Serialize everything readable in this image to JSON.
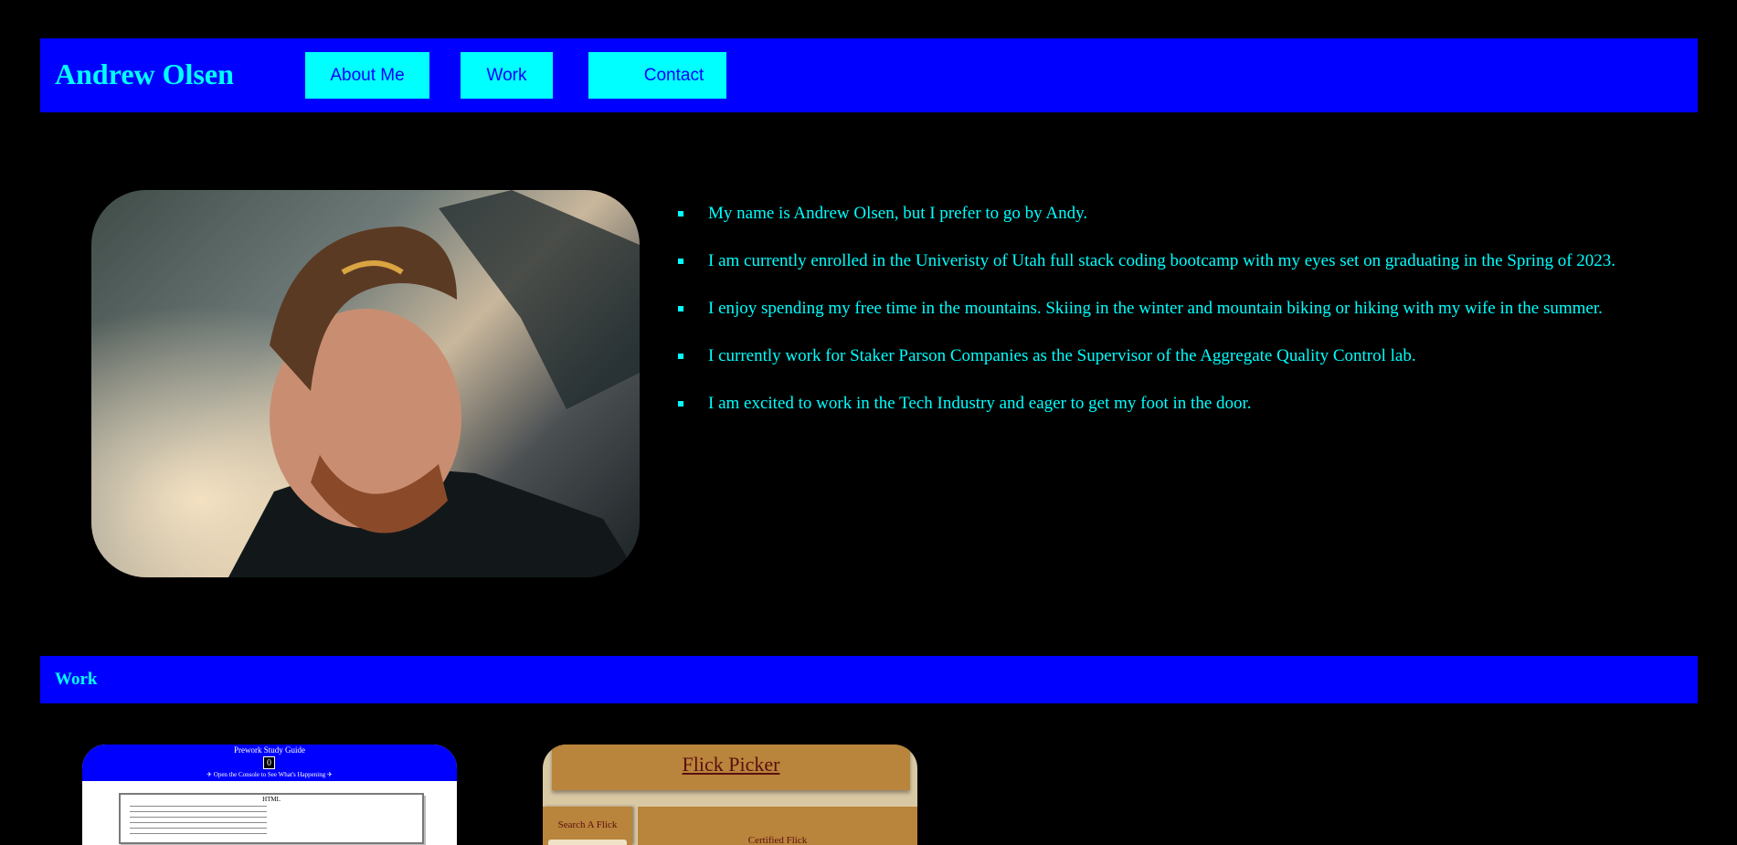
{
  "header": {
    "title": "Andrew Olsen",
    "nav": {
      "about": "About Me",
      "work": "Work",
      "contact": "Contact"
    }
  },
  "about": {
    "items": [
      "My name is Andrew Olsen, but I prefer to go by Andy.",
      "I am currently enrolled in the Univeristy of Utah full stack coding bootcamp with my eyes set on graduating in the Spring of 2023.",
      "I enjoy spending my free time in the mountains. Skiing in the winter and mountain biking or hiking with my wife in the summer.",
      "I currently work for Staker Parson Companies as the Supervisor of the Aggregate Quality Control lab.",
      "I am excited to work in the Tech Industry and eager to get my foot in the door."
    ]
  },
  "work": {
    "heading": "Work",
    "projects": [
      {
        "title": "Prework Study Guide",
        "counter": "0",
        "console_text": "✈ Open the Console to See What's Happening ✈",
        "section": "HTML"
      },
      {
        "title": "Flick Picker",
        "search_label": "Search A Flick",
        "certified_label": "Certified Flick"
      }
    ]
  },
  "colors": {
    "background": "#000000",
    "bar": "#0000ff",
    "accent": "#00ffff"
  }
}
